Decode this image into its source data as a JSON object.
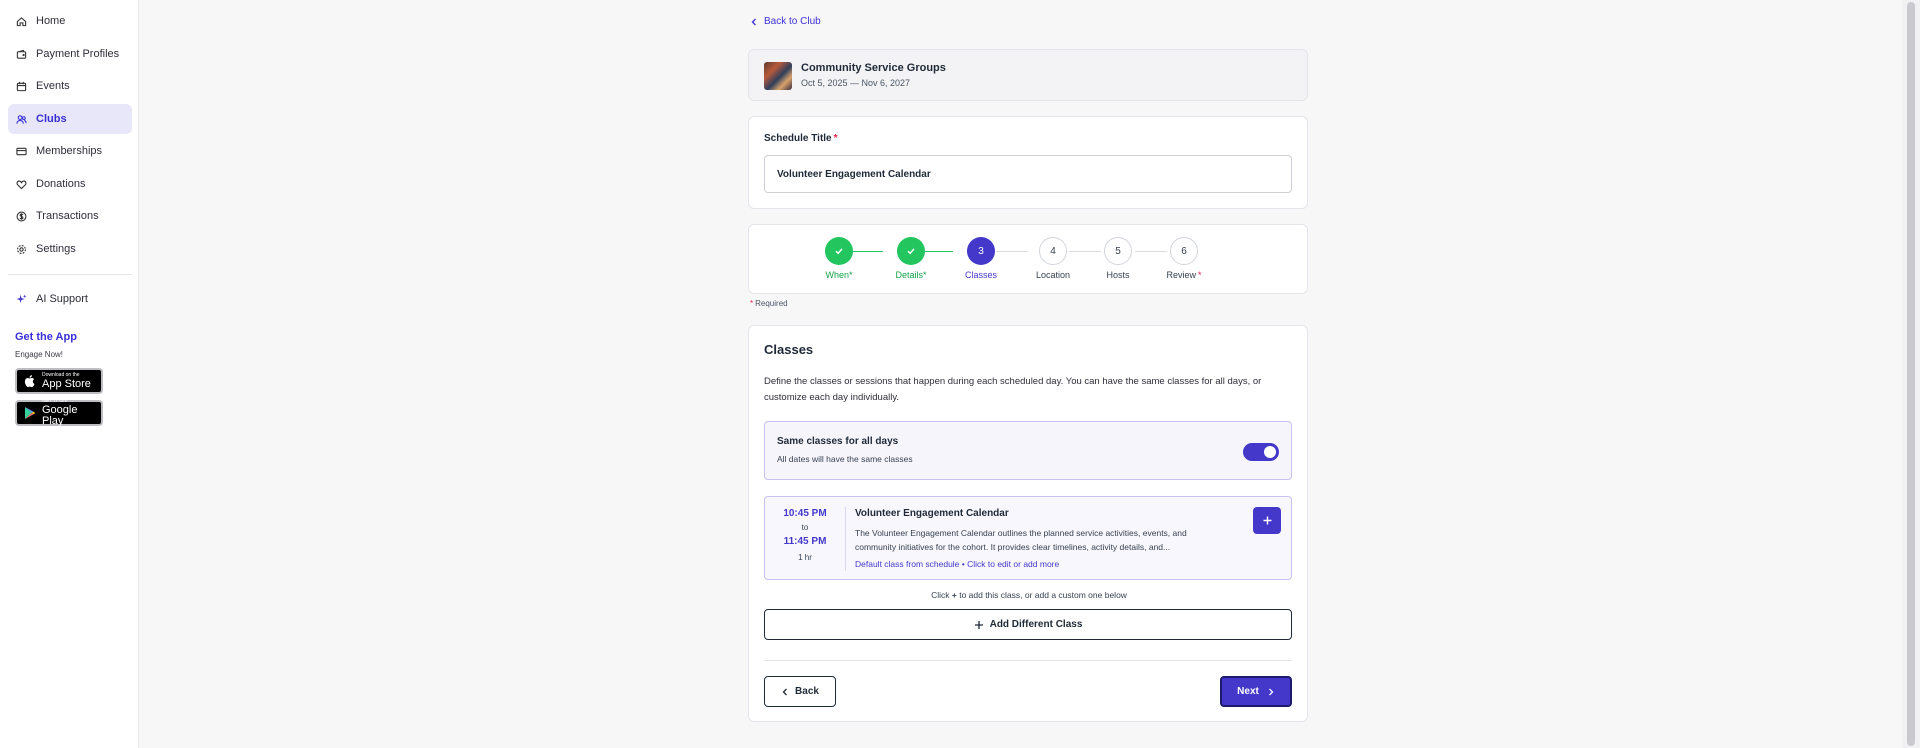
{
  "sidebar": {
    "items": [
      {
        "label": "Home",
        "icon": "home-icon"
      },
      {
        "label": "Payment Profiles",
        "icon": "wallet-icon"
      },
      {
        "label": "Events",
        "icon": "calendar-icon"
      },
      {
        "label": "Clubs",
        "icon": "users-icon",
        "active": true
      },
      {
        "label": "Memberships",
        "icon": "card-icon"
      },
      {
        "label": "Donations",
        "icon": "heart-icon"
      },
      {
        "label": "Transactions",
        "icon": "dollar-icon"
      },
      {
        "label": "Settings",
        "icon": "gear-icon"
      }
    ],
    "ai_support": "AI Support",
    "get_app": "Get the App",
    "get_app_sub": "Engage Now!",
    "app_store": {
      "small": "Download on the",
      "big": "App Store"
    },
    "google_play": {
      "small": "GET IT ON",
      "big": "Google Play"
    }
  },
  "header": {
    "back_label": "Back to Club"
  },
  "club": {
    "name": "Community Service Groups",
    "dates": "Oct 5, 2025 — Nov 6, 2027"
  },
  "schedule": {
    "title_label": "Schedule Title",
    "required_mark": "*",
    "title_value": "Volunteer Engagement Calendar"
  },
  "steps": [
    {
      "num": "",
      "label": "When",
      "req": "*",
      "state": "done"
    },
    {
      "num": "",
      "label": "Details",
      "req": "*",
      "state": "done"
    },
    {
      "num": "3",
      "label": "Classes",
      "req": "",
      "state": "current"
    },
    {
      "num": "4",
      "label": "Location",
      "req": "",
      "state": "todo"
    },
    {
      "num": "5",
      "label": "Hosts",
      "req": "",
      "state": "todo"
    },
    {
      "num": "6",
      "label": "Review",
      "req": "*",
      "state": "todo"
    }
  ],
  "required_note": {
    "mark": "*",
    "text": "Required"
  },
  "classes": {
    "title": "Classes",
    "description": "Define the classes or sessions that happen during each scheduled day. You can have the same classes for all days, or customize each day individually.",
    "same_title": "Same classes for all days",
    "same_sub": "All dates will have the same classes",
    "same_enabled": true,
    "item": {
      "start": "10:45 PM",
      "to": "to",
      "end": "11:45 PM",
      "duration": "1 hr",
      "name": "Volunteer Engagement Calendar",
      "description": "The Volunteer Engagement Calendar outlines the planned service activities, events, and community initiatives for the cohort. It provides clear timelines, activity details, and...",
      "link": "Default class from schedule • Click to edit or add more"
    },
    "hint_pre": "Click",
    "hint_plus": "+",
    "hint_post": "to add this class, or add a custom one below",
    "add_different": "Add Different Class"
  },
  "nav": {
    "back": "Back",
    "next": "Next"
  },
  "colors": {
    "accent": "#4338ca",
    "success": "#22c55e",
    "required": "#e11d48"
  }
}
